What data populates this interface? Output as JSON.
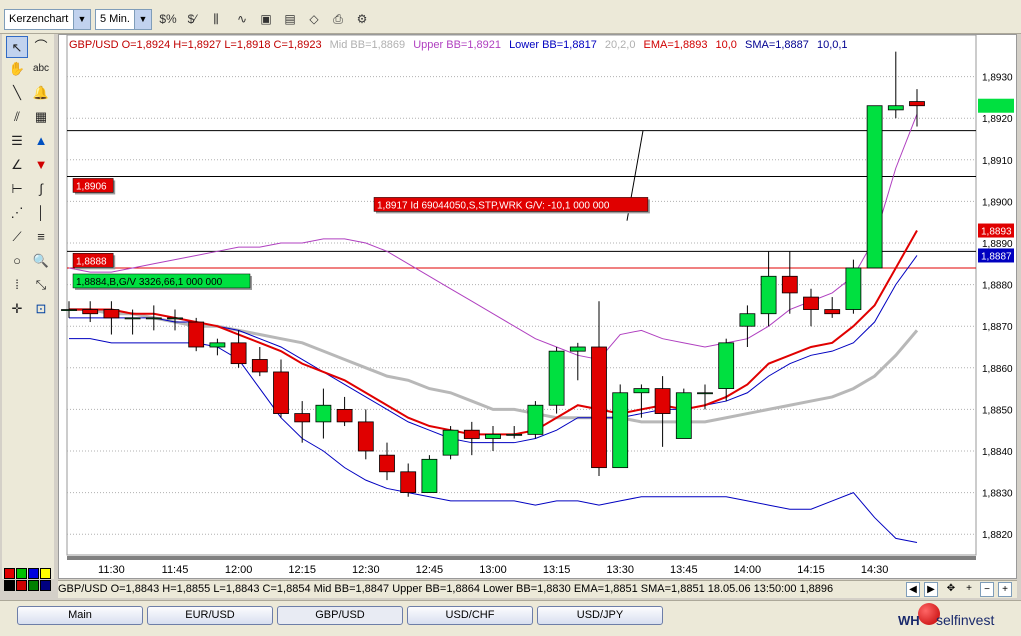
{
  "toolbar": {
    "chart_type": "Kerzenchart",
    "interval": "5 Min.",
    "icons": [
      "dollar-scale-icon",
      "dollar-trend-icon",
      "bars-icon",
      "indicator-icon",
      "chart-window-icon",
      "memo-icon",
      "open-icon",
      "print-icon",
      "settings-icon"
    ]
  },
  "legend": {
    "ohlc": "GBP/USD O=1,8924 H=1,8927 L=1,8918 C=1,8923",
    "mid_bb": "Mid BB=1,8869",
    "upper_bb": "Upper BB=1,8921",
    "lower_bb": "Lower BB=1,8817",
    "bb_params": "20,2,0",
    "ema": "EMA=1,8893",
    "ema_params": "10,0",
    "sma": "SMA=1,8887",
    "sma_params": "10,0,1"
  },
  "colors": {
    "bull": "#00e040",
    "bear": "#e00000",
    "ema": "#e00000",
    "sma": "#0000c0",
    "upper_bb": "#b040c0",
    "lower_bb": "#0000c0",
    "mid_bb": "#b8b8b8",
    "order_line": "#000000",
    "current_line": "#e00000"
  },
  "orders": [
    {
      "label": "1,8906",
      "level": 1.8906,
      "bg": "#e00000",
      "fg": "#ffffff"
    },
    {
      "label": "1,8917 Id 69044050,S,STP,WRK G/V: -10,1 000 000",
      "level": 1.8917,
      "bg": "#e00000",
      "fg": "#ffffff"
    },
    {
      "label": "1,8888",
      "level": 1.8888,
      "bg": "#e00000",
      "fg": "#ffffff"
    },
    {
      "label": "1,8884,B,G/V 3326,66,1 000 000",
      "level": 1.8884,
      "bg": "#00e040",
      "fg": "#000000"
    }
  ],
  "price_tags": [
    {
      "label": "1,8923",
      "value": 1.8923,
      "bg": "#00e040",
      "fg": "#00e040"
    },
    {
      "label": "1,8893",
      "value": 1.8893,
      "bg": "#e00000",
      "fg": "#ffffff"
    },
    {
      "label": "1,8887",
      "value": 1.8887,
      "bg": "#0000c0",
      "fg": "#ffffff"
    }
  ],
  "status": {
    "text": "GBP/USD O=1,8843 H=1,8855 L=1,8843 C=1,8854  Mid BB=1,8847 Upper BB=1,8864 Lower BB=1,8830 EMA=1,8851 SMA=1,8851  18.05.06 13:50:00 1,8896"
  },
  "tabs": [
    "Main",
    "EUR/USD",
    "GBP/USD",
    "USD/CHF",
    "USD/JPY"
  ],
  "active_tab": "GBP/USD",
  "logo": {
    "wh": "WH",
    "name": "selfinvest"
  },
  "palette": [
    "#e00000",
    "#00c000",
    "#0000e0",
    "#ffff00",
    "#000000",
    "#d00000",
    "#008000",
    "#000080"
  ],
  "chart_data": {
    "type": "candlestick",
    "title": "",
    "xlabel": "",
    "ylabel": "",
    "ylim": [
      1.8815,
      1.894
    ],
    "y_ticks": [
      "1,8820",
      "1,8830",
      "1,8840",
      "1,8850",
      "1,8860",
      "1,8870",
      "1,8880",
      "1,8890",
      "1,8900",
      "1,8910",
      "1,8920",
      "1,8930"
    ],
    "y_tick_values": [
      1.882,
      1.883,
      1.884,
      1.885,
      1.886,
      1.887,
      1.888,
      1.889,
      1.89,
      1.891,
      1.892,
      1.893
    ],
    "x_ticks": [
      "11:30",
      "11:45",
      "12:00",
      "12:15",
      "12:30",
      "12:45",
      "13:00",
      "13:15",
      "13:30",
      "13:45",
      "14:00",
      "14:15",
      "14:30"
    ],
    "x_tick_index": [
      2,
      5,
      8,
      11,
      14,
      17,
      20,
      23,
      26,
      29,
      32,
      35,
      38
    ],
    "candles": [
      {
        "t": "11:20",
        "o": 1.8874,
        "h": 1.8876,
        "l": 1.8872,
        "c": 1.8874
      },
      {
        "t": "11:25",
        "o": 1.8874,
        "h": 1.8876,
        "l": 1.8871,
        "c": 1.8873
      },
      {
        "t": "11:30",
        "o": 1.8874,
        "h": 1.8876,
        "l": 1.8868,
        "c": 1.8872
      },
      {
        "t": "11:35",
        "o": 1.8872,
        "h": 1.8874,
        "l": 1.8868,
        "c": 1.8872
      },
      {
        "t": "11:40",
        "o": 1.8872,
        "h": 1.8875,
        "l": 1.8869,
        "c": 1.8872
      },
      {
        "t": "11:45",
        "o": 1.8872,
        "h": 1.8874,
        "l": 1.8869,
        "c": 1.8872
      },
      {
        "t": "11:50",
        "o": 1.8871,
        "h": 1.8872,
        "l": 1.8864,
        "c": 1.8865
      },
      {
        "t": "11:55",
        "o": 1.8865,
        "h": 1.8867,
        "l": 1.8863,
        "c": 1.8866
      },
      {
        "t": "12:00",
        "o": 1.8866,
        "h": 1.8869,
        "l": 1.886,
        "c": 1.8861
      },
      {
        "t": "12:05",
        "o": 1.8862,
        "h": 1.8865,
        "l": 1.8858,
        "c": 1.8859
      },
      {
        "t": "12:10",
        "o": 1.8859,
        "h": 1.8862,
        "l": 1.8848,
        "c": 1.8849
      },
      {
        "t": "12:15",
        "o": 1.8849,
        "h": 1.8852,
        "l": 1.8842,
        "c": 1.8847
      },
      {
        "t": "12:20",
        "o": 1.8847,
        "h": 1.8855,
        "l": 1.8843,
        "c": 1.8851
      },
      {
        "t": "12:25",
        "o": 1.885,
        "h": 1.8853,
        "l": 1.8846,
        "c": 1.8847
      },
      {
        "t": "12:30",
        "o": 1.8847,
        "h": 1.885,
        "l": 1.8838,
        "c": 1.884
      },
      {
        "t": "12:35",
        "o": 1.8839,
        "h": 1.8842,
        "l": 1.8833,
        "c": 1.8835
      },
      {
        "t": "12:40",
        "o": 1.8835,
        "h": 1.8837,
        "l": 1.8829,
        "c": 1.883
      },
      {
        "t": "12:45",
        "o": 1.883,
        "h": 1.8839,
        "l": 1.883,
        "c": 1.8838
      },
      {
        "t": "12:50",
        "o": 1.8839,
        "h": 1.8846,
        "l": 1.8838,
        "c": 1.8845
      },
      {
        "t": "12:55",
        "o": 1.8845,
        "h": 1.8847,
        "l": 1.8839,
        "c": 1.8843
      },
      {
        "t": "13:00",
        "o": 1.8843,
        "h": 1.8846,
        "l": 1.884,
        "c": 1.8844
      },
      {
        "t": "13:05",
        "o": 1.8844,
        "h": 1.8846,
        "l": 1.8843,
        "c": 1.8844
      },
      {
        "t": "13:10",
        "o": 1.8844,
        "h": 1.8852,
        "l": 1.8843,
        "c": 1.8851
      },
      {
        "t": "13:15",
        "o": 1.8851,
        "h": 1.8865,
        "l": 1.8849,
        "c": 1.8864
      },
      {
        "t": "13:20",
        "o": 1.8864,
        "h": 1.8866,
        "l": 1.8857,
        "c": 1.8865
      },
      {
        "t": "13:25",
        "o": 1.8865,
        "h": 1.8876,
        "l": 1.8834,
        "c": 1.8836
      },
      {
        "t": "13:30",
        "o": 1.8836,
        "h": 1.8856,
        "l": 1.8836,
        "c": 1.8854
      },
      {
        "t": "13:35",
        "o": 1.8854,
        "h": 1.8856,
        "l": 1.8848,
        "c": 1.8855
      },
      {
        "t": "13:40",
        "o": 1.8855,
        "h": 1.8858,
        "l": 1.8841,
        "c": 1.8849
      },
      {
        "t": "13:45",
        "o": 1.8843,
        "h": 1.8855,
        "l": 1.8843,
        "c": 1.8854
      },
      {
        "t": "13:50",
        "o": 1.8854,
        "h": 1.8856,
        "l": 1.885,
        "c": 1.8854
      },
      {
        "t": "13:55",
        "o": 1.8855,
        "h": 1.8867,
        "l": 1.8852,
        "c": 1.8866
      },
      {
        "t": "14:00",
        "o": 1.887,
        "h": 1.8875,
        "l": 1.8865,
        "c": 1.8873
      },
      {
        "t": "14:05",
        "o": 1.8873,
        "h": 1.8888,
        "l": 1.887,
        "c": 1.8882
      },
      {
        "t": "14:10",
        "o": 1.8882,
        "h": 1.8888,
        "l": 1.8873,
        "c": 1.8878
      },
      {
        "t": "14:15",
        "o": 1.8877,
        "h": 1.8879,
        "l": 1.887,
        "c": 1.8874
      },
      {
        "t": "14:20",
        "o": 1.8874,
        "h": 1.8877,
        "l": 1.8872,
        "c": 1.8873
      },
      {
        "t": "14:25",
        "o": 1.8874,
        "h": 1.8886,
        "l": 1.8873,
        "c": 1.8884
      },
      {
        "t": "14:30",
        "o": 1.8884,
        "h": 1.8923,
        "l": 1.8884,
        "c": 1.8923
      },
      {
        "t": "14:35",
        "o": 1.8922,
        "h": 1.8936,
        "l": 1.892,
        "c": 1.8923
      },
      {
        "t": "14:40",
        "o": 1.8924,
        "h": 1.8927,
        "l": 1.8918,
        "c": 1.8923
      }
    ],
    "series": [
      {
        "name": "EMA",
        "values": [
          1.8874,
          1.8874,
          1.8874,
          1.8873,
          1.8873,
          1.8872,
          1.8871,
          1.887,
          1.8868,
          1.8866,
          1.8864,
          1.8861,
          1.8859,
          1.8857,
          1.8854,
          1.8851,
          1.8848,
          1.8846,
          1.8845,
          1.8844,
          1.8844,
          1.8844,
          1.8845,
          1.8848,
          1.8851,
          1.885,
          1.8849,
          1.885,
          1.8851,
          1.885,
          1.8851,
          1.8853,
          1.8856,
          1.8861,
          1.8863,
          1.8865,
          1.8866,
          1.887,
          1.8875,
          1.8884,
          1.8893
        ]
      },
      {
        "name": "SMA",
        "values": [
          1.8872,
          1.8872,
          1.8872,
          1.8872,
          1.8872,
          1.8871,
          1.8871,
          1.887,
          1.8869,
          1.8867,
          1.8865,
          1.8862,
          1.8859,
          1.8856,
          1.8853,
          1.885,
          1.8847,
          1.8845,
          1.8843,
          1.8842,
          1.8842,
          1.8842,
          1.8843,
          1.8845,
          1.8848,
          1.8848,
          1.8848,
          1.8849,
          1.885,
          1.885,
          1.8851,
          1.8852,
          1.8854,
          1.8858,
          1.8861,
          1.8863,
          1.8864,
          1.8866,
          1.8871,
          1.888,
          1.8887
        ]
      },
      {
        "name": "Mid BB",
        "values": [
          1.8874,
          1.8874,
          1.8873,
          1.8873,
          1.8872,
          1.8871,
          1.887,
          1.887,
          1.8869,
          1.8868,
          1.8867,
          1.8866,
          1.8864,
          1.8862,
          1.886,
          1.8858,
          1.8857,
          1.8855,
          1.8854,
          1.8852,
          1.885,
          1.885,
          1.8849,
          1.8848,
          1.8848,
          1.8848,
          1.8848,
          1.8847,
          1.8847,
          1.8847,
          1.8847,
          1.8848,
          1.8849,
          1.885,
          1.8851,
          1.8852,
          1.8853,
          1.8855,
          1.8858,
          1.8863,
          1.8869
        ]
      },
      {
        "name": "Upper BB",
        "values": [
          1.8884,
          1.8883,
          1.8883,
          1.8884,
          1.8885,
          1.8886,
          1.8887,
          1.8888,
          1.8889,
          1.8889,
          1.889,
          1.889,
          1.8891,
          1.8891,
          1.889,
          1.8888,
          1.8885,
          1.8882,
          1.8879,
          1.8876,
          1.8873,
          1.887,
          1.8867,
          1.8865,
          1.8863,
          1.8862,
          1.8868,
          1.8869,
          1.8867,
          1.8866,
          1.8865,
          1.8866,
          1.8867,
          1.887,
          1.8874,
          1.8876,
          1.8878,
          1.8882,
          1.8891,
          1.8908,
          1.8921
        ]
      },
      {
        "name": "Lower BB",
        "values": [
          1.8867,
          1.8867,
          1.8866,
          1.8866,
          1.8866,
          1.8866,
          1.8866,
          1.8865,
          1.8862,
          1.8855,
          1.8848,
          1.8843,
          1.884,
          1.8836,
          1.8833,
          1.8831,
          1.883,
          1.8829,
          1.8828,
          1.8828,
          1.8828,
          1.8828,
          1.8827,
          1.8828,
          1.8828,
          1.8827,
          1.8828,
          1.8829,
          1.8829,
          1.8829,
          1.8829,
          1.8829,
          1.8828,
          1.8827,
          1.8826,
          1.8826,
          1.8828,
          1.883,
          1.8824,
          1.8819,
          1.8818
        ]
      }
    ]
  }
}
